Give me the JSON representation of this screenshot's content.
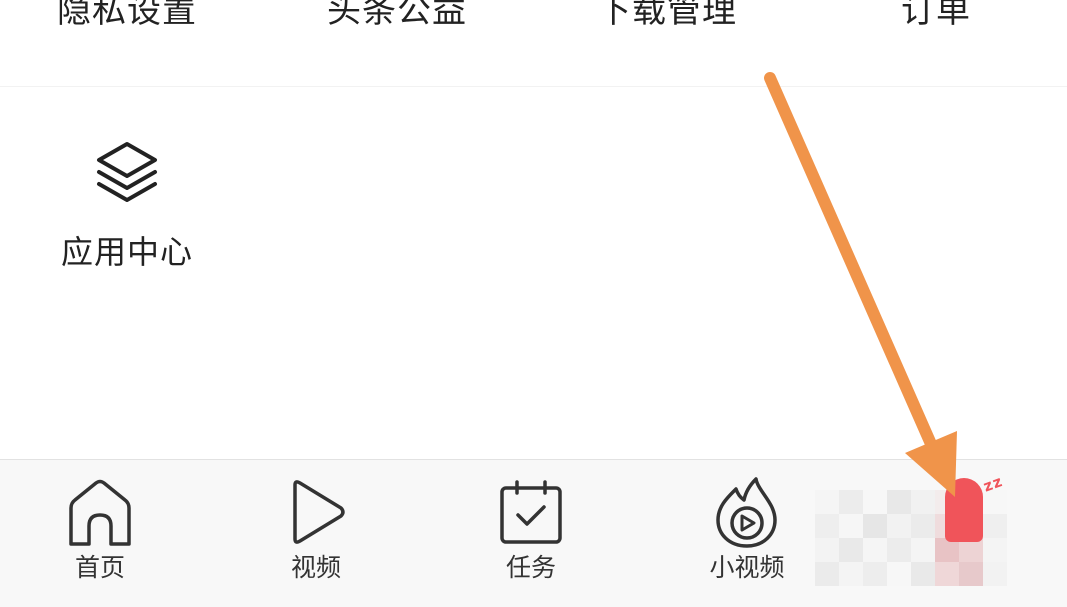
{
  "top_menu": {
    "items": [
      {
        "label": "隐私设置"
      },
      {
        "label": "头条公益"
      },
      {
        "label": "下载管理"
      },
      {
        "label": "订单"
      }
    ]
  },
  "app_center": {
    "label": "应用中心",
    "icon": "layers-icon"
  },
  "bottom_nav": {
    "items": [
      {
        "label": "首页",
        "icon": "home-icon"
      },
      {
        "label": "视频",
        "icon": "play-icon"
      },
      {
        "label": "任务",
        "icon": "calendar-check-icon"
      },
      {
        "label": "小视频",
        "icon": "flame-play-icon"
      }
    ],
    "profile_item": {
      "icon": "avatar-icon",
      "badge": "zz"
    }
  },
  "colors": {
    "text": "#222222",
    "nav_text": "#333333",
    "nav_background": "#f8f8f8",
    "annotation_arrow": "#f0944a",
    "avatar_red": "#f0545a"
  }
}
